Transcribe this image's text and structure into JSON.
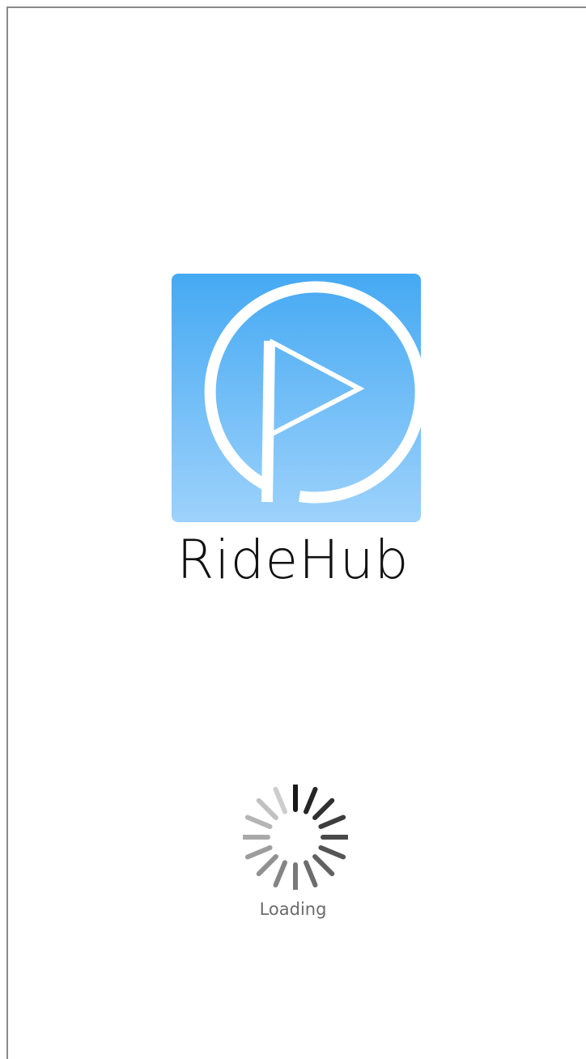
{
  "app": {
    "name": "RideHub",
    "loading_text": "Loading"
  },
  "icons": {
    "logo": "play-flag-logo-icon",
    "spinner": "loading-spinner-icon"
  },
  "colors": {
    "tile_top": "#45a9f3",
    "tile_bottom": "#9dd2fb",
    "text_primary": "#111111",
    "text_secondary": "#6b6b6b"
  }
}
